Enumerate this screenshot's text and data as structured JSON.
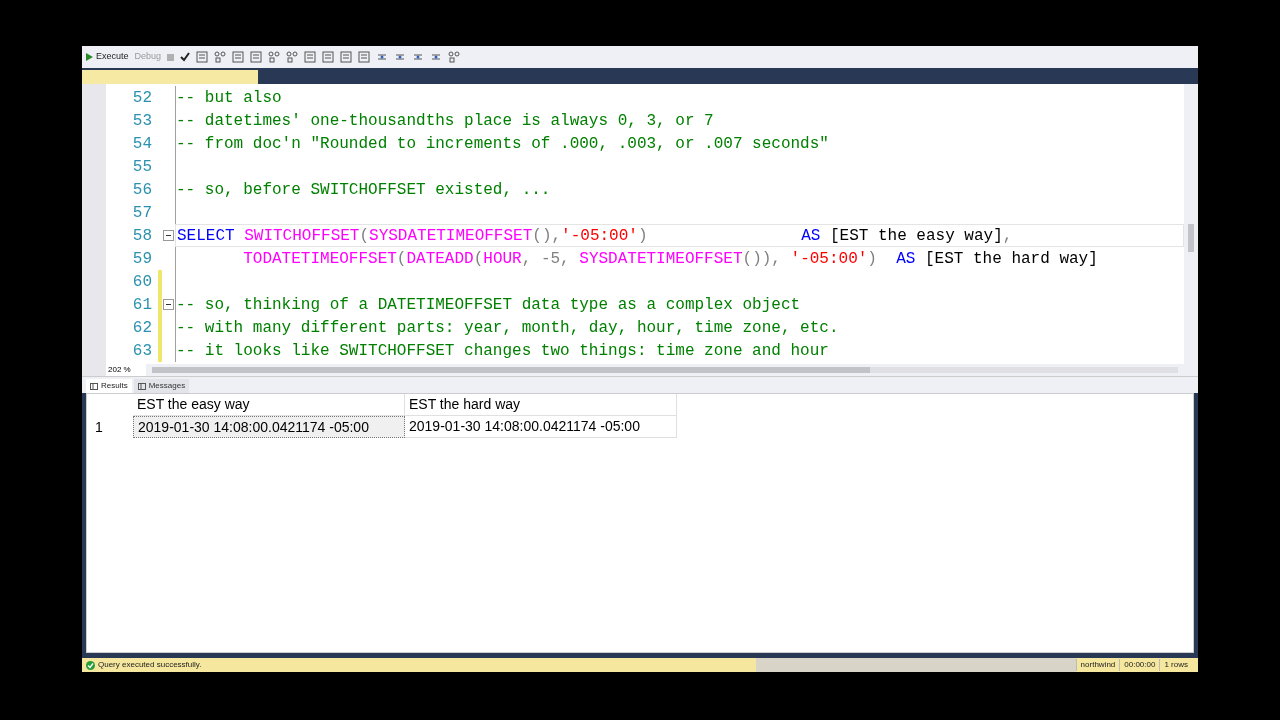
{
  "toolbar": {
    "execute": "Execute",
    "debug": "Debug"
  },
  "editor": {
    "lines": [
      {
        "number": "52",
        "current": false,
        "collapse": false,
        "changed": false,
        "tokens": [
          {
            "kind": "comment",
            "text": "-- but also"
          }
        ]
      },
      {
        "number": "53",
        "current": false,
        "collapse": false,
        "changed": false,
        "tokens": [
          {
            "kind": "comment",
            "text": "-- datetimes' one-thousandths place is always 0, 3, or 7"
          }
        ]
      },
      {
        "number": "54",
        "current": false,
        "collapse": false,
        "changed": false,
        "tokens": [
          {
            "kind": "comment",
            "text": "-- from doc'n \"Rounded to increments of .000, .003, or .007 seconds\""
          }
        ]
      },
      {
        "number": "55",
        "current": false,
        "collapse": false,
        "changed": false
      },
      {
        "number": "56",
        "current": false,
        "collapse": false,
        "changed": false,
        "tokens": [
          {
            "kind": "comment",
            "text": "-- so, before SWITCHOFFSET existed, ..."
          }
        ]
      },
      {
        "number": "57",
        "current": false,
        "collapse": false,
        "changed": false
      },
      {
        "number": "58",
        "current": true,
        "collapse": true,
        "changed": false,
        "tokens": [
          {
            "kind": "keyword",
            "text": "SELECT"
          },
          {
            "kind": "func",
            "text": " SWITCHOFFSET"
          },
          {
            "kind": "punct",
            "text": "("
          },
          {
            "kind": "func",
            "text": "SYSDATETIMEOFFSET"
          },
          {
            "kind": "punct",
            "text": "(),"
          },
          {
            "kind": "string",
            "text": "'-05:00'"
          },
          {
            "kind": "punct",
            "text": ")                "
          },
          {
            "kind": "keyword",
            "text": "AS"
          },
          {
            "kind": "plain",
            "text": " [EST the easy way]"
          },
          {
            "kind": "punct",
            "text": ","
          }
        ]
      },
      {
        "number": "59",
        "current": false,
        "collapse": false,
        "changed": false,
        "tokens": [
          {
            "kind": "func",
            "text": "       TODATETIMEOFFSET"
          },
          {
            "kind": "punct",
            "text": "("
          },
          {
            "kind": "func",
            "text": "DATEADD"
          },
          {
            "kind": "punct",
            "text": "("
          },
          {
            "kind": "func",
            "text": "HOUR"
          },
          {
            "kind": "punct",
            "text": ", -5, "
          },
          {
            "kind": "func",
            "text": "SYSDATETIMEOFFSET"
          },
          {
            "kind": "punct",
            "text": "()), "
          },
          {
            "kind": "string",
            "text": "'-05:00'"
          },
          {
            "kind": "punct",
            "text": ")  "
          },
          {
            "kind": "keyword",
            "text": "AS"
          },
          {
            "kind": "plain",
            "text": " [EST the hard way]"
          }
        ]
      },
      {
        "number": "60",
        "current": false,
        "collapse": false,
        "changed": true
      },
      {
        "number": "61",
        "current": false,
        "collapse": true,
        "changed": true,
        "tokens": [
          {
            "kind": "comment",
            "text": "-- so, thinking of a DATETIMEOFFSET data type as a complex object"
          }
        ]
      },
      {
        "number": "62",
        "current": false,
        "collapse": false,
        "changed": true,
        "tokens": [
          {
            "kind": "comment",
            "text": "-- with many different parts: year, month, day, hour, time zone, etc."
          }
        ]
      },
      {
        "number": "63",
        "current": false,
        "collapse": false,
        "changed": true,
        "tokens": [
          {
            "kind": "comment",
            "text": "-- it looks like SWITCHOFFSET changes two things: time zone and hour"
          }
        ]
      }
    ],
    "zoom": "202 %"
  },
  "result_tabs": [
    {
      "label": "Results",
      "selected": true
    },
    {
      "label": "Messages",
      "selected": false
    }
  ],
  "grid": {
    "columns": [
      "EST the easy way",
      "EST the hard way"
    ],
    "rows": [
      {
        "number": "1",
        "cells": [
          {
            "text": "2019-01-30 14:08:00.0421174 -05:00",
            "selected": true
          },
          {
            "text": "2019-01-30 14:08:00.0421174 -05:00",
            "selected": false
          }
        ]
      }
    ]
  },
  "status_bar": {
    "message": "Query executed successfully.",
    "database": "northwind",
    "time": "00:00:00",
    "rows": "1 rows"
  }
}
